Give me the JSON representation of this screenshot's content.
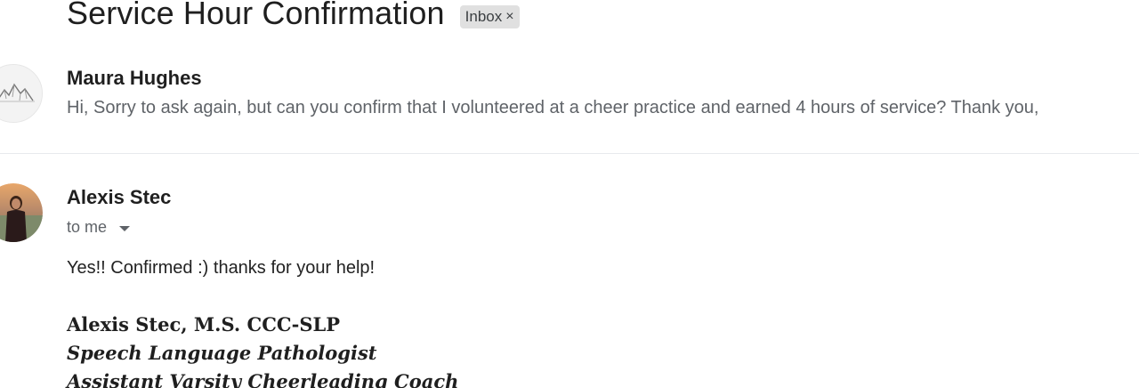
{
  "thread": {
    "subject": "Service Hour Confirmation",
    "label": "Inbox",
    "label_remove": "×"
  },
  "messages": [
    {
      "sender": "Maura Hughes",
      "snippet": "Hi, Sorry to ask again, but can you confirm that I volunteered at a cheer practice and earned 4 hours of service? Thank you,",
      "avatar_icon": "mountain-sketch-avatar"
    },
    {
      "sender": "Alexis Stec",
      "recipient": "to me",
      "avatar_icon": "person-photo-avatar",
      "body": "Yes!! Confirmed :) thanks for your help!",
      "signature": [
        "Alexis Stec, M.S. CCC-SLP",
        "Speech Language Pathologist",
        "Assistant Varsity Cheerleading Coach"
      ]
    }
  ],
  "colors": {
    "chip_bg": "#e0e0e0",
    "muted_text": "#5f6368",
    "primary_text": "#1f1f1f",
    "divider": "#e8eaed"
  }
}
